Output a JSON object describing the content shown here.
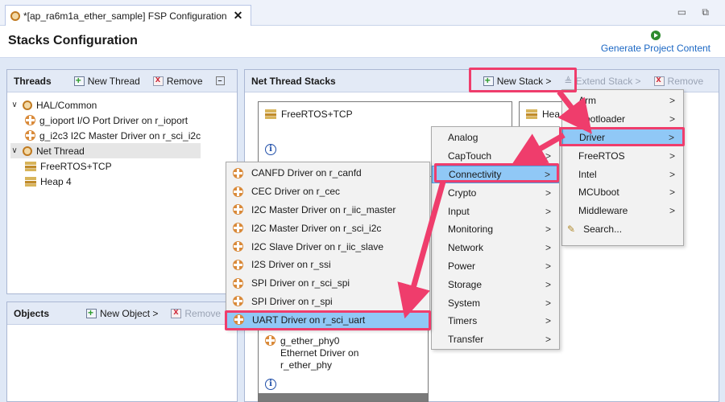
{
  "editor_tab": {
    "title": "*[ap_ra6m1a_ether_sample] FSP Configuration",
    "close": "✕"
  },
  "window_controls": "▭ ⧉",
  "header": {
    "title": "Stacks Configuration",
    "generate": "Generate Project Content"
  },
  "threads_panel": {
    "title": "Threads",
    "new_thread": "New Thread",
    "remove": "Remove",
    "tree": [
      {
        "label": "HAL/Common",
        "level": 0,
        "expanded": true
      },
      {
        "label": "g_ioport I/O Port Driver on r_ioport",
        "level": 1
      },
      {
        "label": "g_i2c3 I2C Master Driver on r_sci_i2c",
        "level": 1
      },
      {
        "label": "Net Thread",
        "level": 0,
        "expanded": true,
        "selected": true
      },
      {
        "label": "FreeRTOS+TCP",
        "level": 1
      },
      {
        "label": "Heap 4",
        "level": 1
      }
    ]
  },
  "objects_panel": {
    "title": "Objects",
    "new_object": "New Object >",
    "remove": "Remove"
  },
  "stacks_panel": {
    "title": "Net Thread Stacks",
    "new_stack": "New Stack >",
    "extend_stack": "Extend Stack >",
    "remove": "Remove",
    "card_freertos": "FreeRTOS+TCP",
    "card_heap": "Hea",
    "card_ether_name": "g_ether_phy0",
    "card_ether_desc": "Ethernet Driver on",
    "card_ether_mod": "r_ether_phy",
    "info_glyph": "i"
  },
  "menu_level1": [
    {
      "label": "Arm",
      "submenu": true
    },
    {
      "label": "Bootloader",
      "submenu": true
    },
    {
      "label": "Driver",
      "submenu": true,
      "highlighted": true
    },
    {
      "label": "FreeRTOS",
      "submenu": true
    },
    {
      "label": "Intel",
      "submenu": true
    },
    {
      "label": "MCUboot",
      "submenu": true
    },
    {
      "label": "Middleware",
      "submenu": true
    },
    {
      "label": "Search...",
      "submenu": false
    }
  ],
  "menu_level2": [
    {
      "label": "Analog"
    },
    {
      "label": "CapTouch"
    },
    {
      "label": "Connectivity",
      "highlighted": true
    },
    {
      "label": "Crypto"
    },
    {
      "label": "Input"
    },
    {
      "label": "Monitoring"
    },
    {
      "label": "Network"
    },
    {
      "label": "Power"
    },
    {
      "label": "Storage"
    },
    {
      "label": "System"
    },
    {
      "label": "Timers"
    },
    {
      "label": "Transfer"
    }
  ],
  "menu_level3": [
    {
      "label": "CANFD Driver on r_canfd"
    },
    {
      "label": "CEC Driver on r_cec"
    },
    {
      "label": "I2C Master Driver on r_iic_master"
    },
    {
      "label": "I2C Master Driver on r_sci_i2c"
    },
    {
      "label": "I2C Slave Driver on r_iic_slave"
    },
    {
      "label": "I2S Driver on r_ssi"
    },
    {
      "label": "SPI Driver on r_sci_spi"
    },
    {
      "label": "SPI Driver on r_spi"
    },
    {
      "label": "UART Driver on r_sci_uart",
      "highlighted": true
    }
  ],
  "submenu_arrow": ">",
  "annotation_color": "#ef3d6c"
}
